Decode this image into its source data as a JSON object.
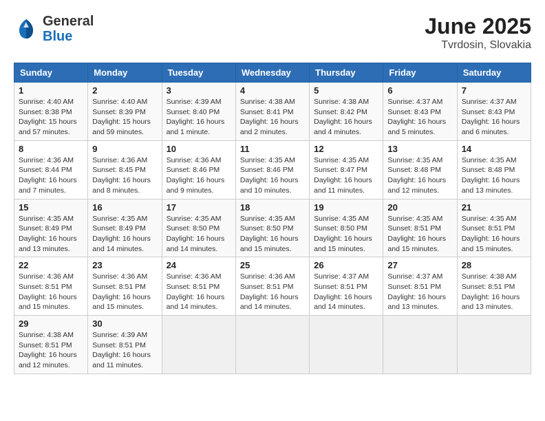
{
  "header": {
    "logo": {
      "general": "General",
      "blue": "Blue"
    },
    "title": "June 2025",
    "subtitle": "Tvrdosin, Slovakia"
  },
  "calendar": {
    "days_of_week": [
      "Sunday",
      "Monday",
      "Tuesday",
      "Wednesday",
      "Thursday",
      "Friday",
      "Saturday"
    ],
    "weeks": [
      [
        null,
        {
          "day": 2,
          "sunrise": "Sunrise: 4:40 AM",
          "sunset": "Sunset: 8:39 PM",
          "daylight": "Daylight: 15 hours and 59 minutes."
        },
        {
          "day": 3,
          "sunrise": "Sunrise: 4:39 AM",
          "sunset": "Sunset: 8:40 PM",
          "daylight": "Daylight: 16 hours and 1 minute."
        },
        {
          "day": 4,
          "sunrise": "Sunrise: 4:38 AM",
          "sunset": "Sunset: 8:41 PM",
          "daylight": "Daylight: 16 hours and 2 minutes."
        },
        {
          "day": 5,
          "sunrise": "Sunrise: 4:38 AM",
          "sunset": "Sunset: 8:42 PM",
          "daylight": "Daylight: 16 hours and 4 minutes."
        },
        {
          "day": 6,
          "sunrise": "Sunrise: 4:37 AM",
          "sunset": "Sunset: 8:43 PM",
          "daylight": "Daylight: 16 hours and 5 minutes."
        },
        {
          "day": 7,
          "sunrise": "Sunrise: 4:37 AM",
          "sunset": "Sunset: 8:43 PM",
          "daylight": "Daylight: 16 hours and 6 minutes."
        }
      ],
      [
        {
          "day": 1,
          "sunrise": "Sunrise: 4:40 AM",
          "sunset": "Sunset: 8:38 PM",
          "daylight": "Daylight: 15 hours and 57 minutes."
        },
        {
          "day": 9,
          "sunrise": "Sunrise: 4:36 AM",
          "sunset": "Sunset: 8:45 PM",
          "daylight": "Daylight: 16 hours and 8 minutes."
        },
        {
          "day": 10,
          "sunrise": "Sunrise: 4:36 AM",
          "sunset": "Sunset: 8:46 PM",
          "daylight": "Daylight: 16 hours and 9 minutes."
        },
        {
          "day": 11,
          "sunrise": "Sunrise: 4:35 AM",
          "sunset": "Sunset: 8:46 PM",
          "daylight": "Daylight: 16 hours and 10 minutes."
        },
        {
          "day": 12,
          "sunrise": "Sunrise: 4:35 AM",
          "sunset": "Sunset: 8:47 PM",
          "daylight": "Daylight: 16 hours and 11 minutes."
        },
        {
          "day": 13,
          "sunrise": "Sunrise: 4:35 AM",
          "sunset": "Sunset: 8:48 PM",
          "daylight": "Daylight: 16 hours and 12 minutes."
        },
        {
          "day": 14,
          "sunrise": "Sunrise: 4:35 AM",
          "sunset": "Sunset: 8:48 PM",
          "daylight": "Daylight: 16 hours and 13 minutes."
        }
      ],
      [
        {
          "day": 8,
          "sunrise": "Sunrise: 4:36 AM",
          "sunset": "Sunset: 8:44 PM",
          "daylight": "Daylight: 16 hours and 7 minutes."
        },
        {
          "day": 16,
          "sunrise": "Sunrise: 4:35 AM",
          "sunset": "Sunset: 8:49 PM",
          "daylight": "Daylight: 16 hours and 14 minutes."
        },
        {
          "day": 17,
          "sunrise": "Sunrise: 4:35 AM",
          "sunset": "Sunset: 8:50 PM",
          "daylight": "Daylight: 16 hours and 14 minutes."
        },
        {
          "day": 18,
          "sunrise": "Sunrise: 4:35 AM",
          "sunset": "Sunset: 8:50 PM",
          "daylight": "Daylight: 16 hours and 15 minutes."
        },
        {
          "day": 19,
          "sunrise": "Sunrise: 4:35 AM",
          "sunset": "Sunset: 8:50 PM",
          "daylight": "Daylight: 16 hours and 15 minutes."
        },
        {
          "day": 20,
          "sunrise": "Sunrise: 4:35 AM",
          "sunset": "Sunset: 8:51 PM",
          "daylight": "Daylight: 16 hours and 15 minutes."
        },
        {
          "day": 21,
          "sunrise": "Sunrise: 4:35 AM",
          "sunset": "Sunset: 8:51 PM",
          "daylight": "Daylight: 16 hours and 15 minutes."
        }
      ],
      [
        {
          "day": 15,
          "sunrise": "Sunrise: 4:35 AM",
          "sunset": "Sunset: 8:49 PM",
          "daylight": "Daylight: 16 hours and 13 minutes."
        },
        {
          "day": 23,
          "sunrise": "Sunrise: 4:36 AM",
          "sunset": "Sunset: 8:51 PM",
          "daylight": "Daylight: 16 hours and 15 minutes."
        },
        {
          "day": 24,
          "sunrise": "Sunrise: 4:36 AM",
          "sunset": "Sunset: 8:51 PM",
          "daylight": "Daylight: 16 hours and 14 minutes."
        },
        {
          "day": 25,
          "sunrise": "Sunrise: 4:36 AM",
          "sunset": "Sunset: 8:51 PM",
          "daylight": "Daylight: 16 hours and 14 minutes."
        },
        {
          "day": 26,
          "sunrise": "Sunrise: 4:37 AM",
          "sunset": "Sunset: 8:51 PM",
          "daylight": "Daylight: 16 hours and 14 minutes."
        },
        {
          "day": 27,
          "sunrise": "Sunrise: 4:37 AM",
          "sunset": "Sunset: 8:51 PM",
          "daylight": "Daylight: 16 hours and 13 minutes."
        },
        {
          "day": 28,
          "sunrise": "Sunrise: 4:38 AM",
          "sunset": "Sunset: 8:51 PM",
          "daylight": "Daylight: 16 hours and 13 minutes."
        }
      ],
      [
        {
          "day": 22,
          "sunrise": "Sunrise: 4:36 AM",
          "sunset": "Sunset: 8:51 PM",
          "daylight": "Daylight: 16 hours and 15 minutes."
        },
        {
          "day": 30,
          "sunrise": "Sunrise: 4:39 AM",
          "sunset": "Sunset: 8:51 PM",
          "daylight": "Daylight: 16 hours and 11 minutes."
        },
        null,
        null,
        null,
        null,
        null
      ],
      [
        {
          "day": 29,
          "sunrise": "Sunrise: 4:38 AM",
          "sunset": "Sunset: 8:51 PM",
          "daylight": "Daylight: 16 hours and 12 minutes."
        },
        null,
        null,
        null,
        null,
        null,
        null
      ]
    ]
  }
}
